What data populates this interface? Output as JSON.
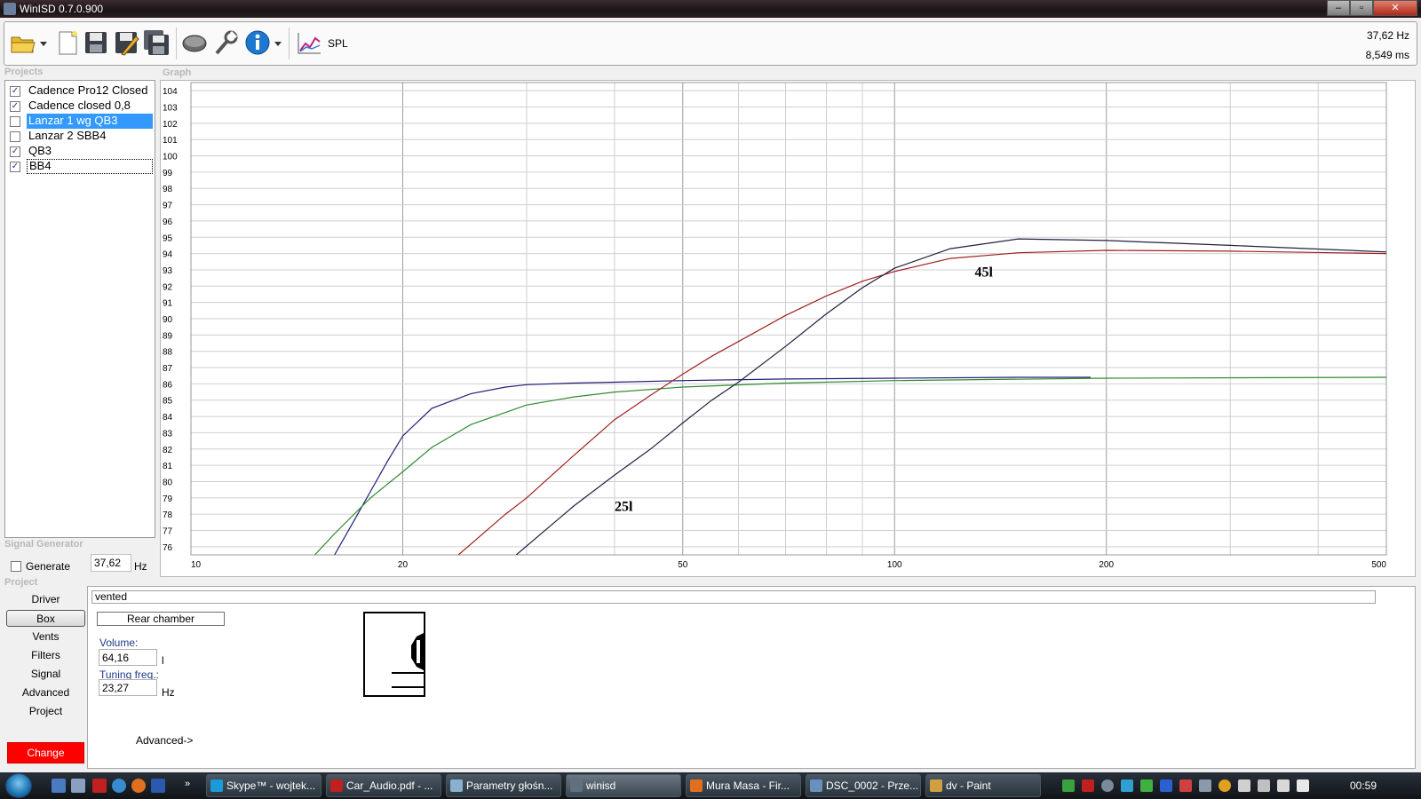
{
  "window": {
    "title": "WinISD 0.7.0.900"
  },
  "toolbar": {
    "spl_label": "SPL"
  },
  "readout": {
    "frequency": "37,62 Hz",
    "time": "8,549 ms"
  },
  "sections": {
    "projects": "Projects",
    "graph": "Graph",
    "signal_generator": "Signal Generator",
    "project": "Project"
  },
  "projects": [
    {
      "label": "Cadence Pro12 Closed",
      "checked": true,
      "selected": false,
      "focused": false
    },
    {
      "label": "Cadence closed 0,8",
      "checked": true,
      "selected": false,
      "focused": false
    },
    {
      "label": "Lanzar 1 wg QB3",
      "checked": false,
      "selected": true,
      "focused": false
    },
    {
      "label": "Lanzar 2 SBB4",
      "checked": false,
      "selected": false,
      "focused": false
    },
    {
      "label": "QB3",
      "checked": true,
      "selected": false,
      "focused": false
    },
    {
      "label": "BB4",
      "checked": true,
      "selected": false,
      "focused": true
    }
  ],
  "signal_generator": {
    "generate_label": "Generate",
    "value": "37,62",
    "unit": "Hz"
  },
  "nav": {
    "items": [
      "Driver",
      "Box",
      "Vents",
      "Filters",
      "Signal",
      "Advanced",
      "Project"
    ],
    "active": "Box",
    "change_label": "Change"
  },
  "box": {
    "type": "vented",
    "rear_chamber_label": "Rear chamber",
    "volume_label": "Volume:",
    "volume_value": "64,16",
    "volume_unit": "l",
    "tuning_label": "Tuning freq.:",
    "tuning_value": "23,27",
    "tuning_unit": "Hz",
    "advanced_label": "Advanced->"
  },
  "chart_data": {
    "type": "line",
    "xscale": "log",
    "xlim": [
      10,
      500
    ],
    "ylim": [
      75.5,
      104.5
    ],
    "x_ticks": [
      10,
      20,
      50,
      100,
      200,
      500
    ],
    "y_ticks": [
      76,
      77,
      78,
      79,
      80,
      81,
      82,
      83,
      84,
      85,
      86,
      87,
      88,
      89,
      90,
      91,
      92,
      93,
      94,
      95,
      96,
      97,
      98,
      99,
      100,
      101,
      102,
      103,
      104
    ],
    "annotations": [
      {
        "text": "45l",
        "x": 130,
        "y": 92.6
      },
      {
        "text": "25l",
        "x": 40,
        "y": 78.2
      }
    ],
    "series": [
      {
        "color": "#1e1e78",
        "x": [
          16,
          17,
          18,
          19,
          20,
          22,
          25,
          28,
          30,
          35,
          40,
          50,
          70,
          100,
          150,
          190
        ],
        "y": [
          75.5,
          77.5,
          79.4,
          81.2,
          82.8,
          84.5,
          85.4,
          85.8,
          85.95,
          86.05,
          86.1,
          86.2,
          86.3,
          86.35,
          86.4,
          86.4
        ]
      },
      {
        "color": "#2e8b2e",
        "x": [
          15,
          16,
          18,
          20,
          22,
          25,
          30,
          35,
          40,
          50,
          70,
          100,
          200,
          500
        ],
        "y": [
          75.5,
          76.8,
          79.0,
          80.6,
          82.1,
          83.5,
          84.7,
          85.2,
          85.5,
          85.8,
          86.05,
          86.2,
          86.35,
          86.4
        ]
      },
      {
        "color": "#a02020",
        "x": [
          24,
          28,
          30,
          35,
          40,
          45,
          50,
          55,
          60,
          70,
          80,
          90,
          100,
          120,
          150,
          200,
          300,
          500
        ],
        "y": [
          75.5,
          78.0,
          79.0,
          81.6,
          83.8,
          85.3,
          86.6,
          87.7,
          88.6,
          90.2,
          91.4,
          92.3,
          92.9,
          93.7,
          94.05,
          94.2,
          94.15,
          94.0
        ]
      },
      {
        "color": "#202040",
        "x": [
          29,
          35,
          40,
          45,
          50,
          55,
          60,
          70,
          80,
          90,
          100,
          120,
          150,
          200,
          300,
          500
        ],
        "y": [
          75.5,
          78.5,
          80.4,
          82.0,
          83.6,
          85.0,
          86.1,
          88.3,
          90.3,
          91.9,
          93.1,
          94.3,
          94.9,
          94.8,
          94.5,
          94.1
        ]
      }
    ]
  }
}
